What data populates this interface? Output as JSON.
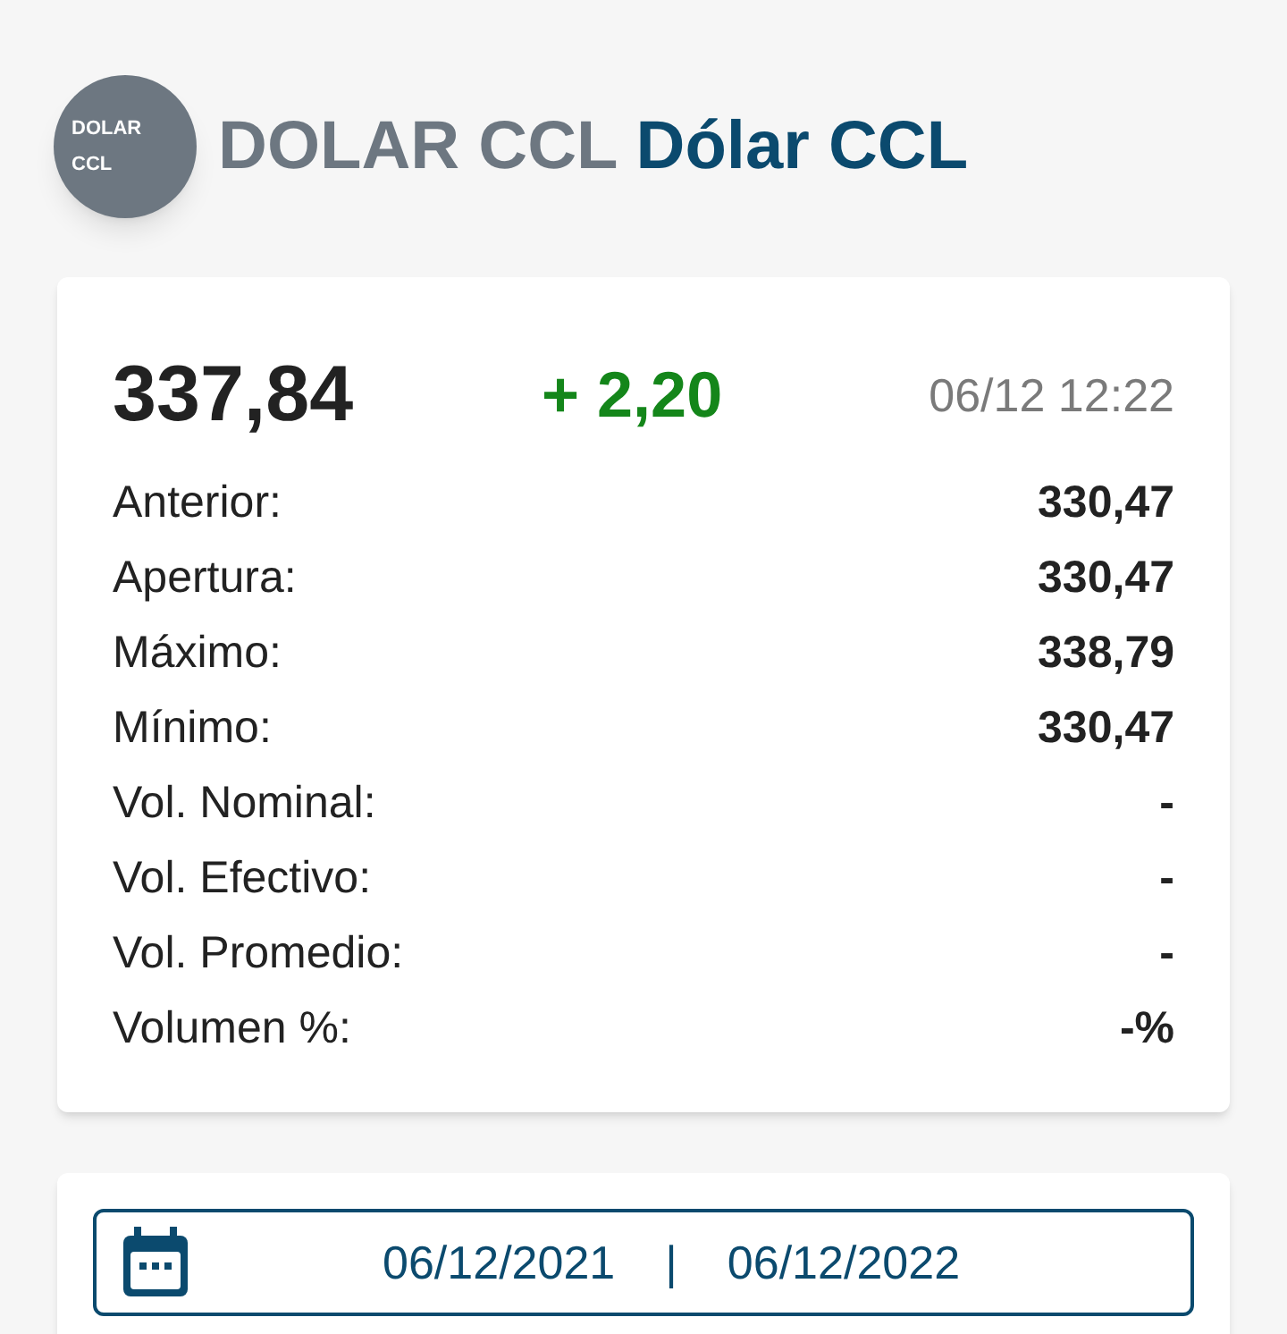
{
  "header": {
    "avatar_lines": [
      "DOLAR",
      "CCL"
    ],
    "ticker": "DOLAR CCL",
    "name": "Dólar CCL"
  },
  "quote": {
    "price": "337,84",
    "change": "+ 2,20",
    "time": "06/12 12:22",
    "rows": [
      {
        "label": "Anterior:",
        "value": "330,47"
      },
      {
        "label": "Apertura:",
        "value": "330,47"
      },
      {
        "label": "Máximo:",
        "value": "338,79"
      },
      {
        "label": "Mínimo:",
        "value": "330,47"
      },
      {
        "label": "Vol. Nominal:",
        "value": "-"
      },
      {
        "label": "Vol. Efectivo:",
        "value": "-"
      },
      {
        "label": "Vol. Promedio:",
        "value": "-"
      },
      {
        "label": "Volumen %:",
        "value": "-%"
      }
    ]
  },
  "date_range": {
    "from": "06/12/2021",
    "separator": "|",
    "to": "06/12/2022"
  }
}
